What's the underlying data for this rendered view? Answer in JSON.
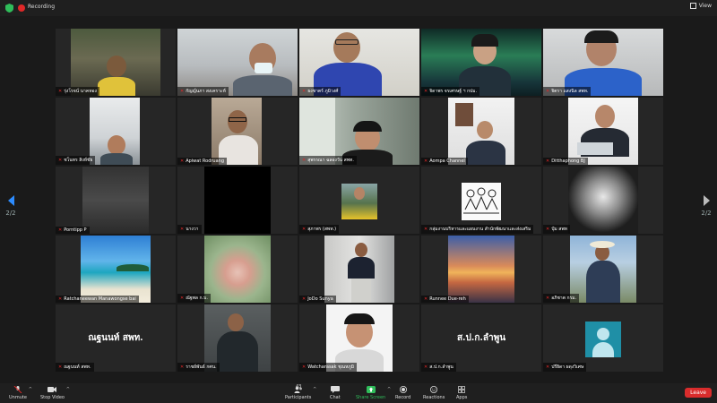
{
  "topbar": {
    "recording_label": "Recording",
    "view_label": "View"
  },
  "pager": {
    "left": "2/2",
    "right": "2/2"
  },
  "tiles": [
    {
      "name": "รุ่งโรจน์ นาคทอง",
      "muted": true
    },
    {
      "name": "กัญญ์นภา สงเคราะห์",
      "muted": true
    },
    {
      "name": "ธงชาตร์ ภูมิวงศ์",
      "muted": true
    },
    {
      "name": "จิดาพร จรเศรษฐ์ ฯ กปม.",
      "muted": true
    },
    {
      "name": "จิตรา แสงนิล สพท.",
      "muted": true
    },
    {
      "name": "ชโนทร สิงห์ชัย",
      "muted": true
    },
    {
      "name": "Apiwat Rodruang",
      "muted": true
    },
    {
      "name": "สุพรรณา ฉลองวัน สพท.",
      "muted": true
    },
    {
      "name": "Aompa Channel",
      "muted": true
    },
    {
      "name": "Ditthaphong BJ",
      "muted": true
    },
    {
      "name": "Porntipp P",
      "muted": true
    },
    {
      "name": "นางวา",
      "muted": true
    },
    {
      "name": "สุภาพร (สพท.)",
      "muted": true
    },
    {
      "name": "กลุ่มงานบริหารและแผนงาน สำนักพัฒนาและส่งเสริม",
      "muted": true
    },
    {
      "name": "ปุ๋ม สพท",
      "muted": true
    },
    {
      "name": "Ratchaneewan Manawongse bai",
      "muted": true
    },
    {
      "name": "ณัฐพล ก.บ.",
      "muted": true
    },
    {
      "name": "JoDo Sunya",
      "muted": true
    },
    {
      "name": "Runnee Due-reh",
      "muted": true
    },
    {
      "name": "อภิชาต กรม.",
      "muted": true
    },
    {
      "name": "ณฐนนท์ สพท.",
      "muted": true,
      "big_text": "ณฐนนท์ สพท."
    },
    {
      "name": "ราชย์พันธ์ กศน.",
      "muted": true
    },
    {
      "name": "Watcharasak ชุณหภูมิ",
      "muted": true
    },
    {
      "name": "ส.ป.ก.ลำพูน",
      "muted": true,
      "big_text": "ส.ป.ก.ลำพูน"
    },
    {
      "name": "ปรียิดา ผดุงวิเศษ",
      "muted": true
    }
  ],
  "toolbar": {
    "unmute": "Unmute",
    "stop_video": "Stop Video",
    "participants": "Participants",
    "participants_count": "43",
    "chat": "Chat",
    "share_screen": "Share Screen",
    "record": "Record",
    "reactions": "Reactions",
    "apps": "Apps",
    "leave": "Leave"
  },
  "colors": {
    "accent": "#2d8cff",
    "share": "#2fbd5a",
    "record": "#e02828",
    "leave": "#d92c2c"
  }
}
